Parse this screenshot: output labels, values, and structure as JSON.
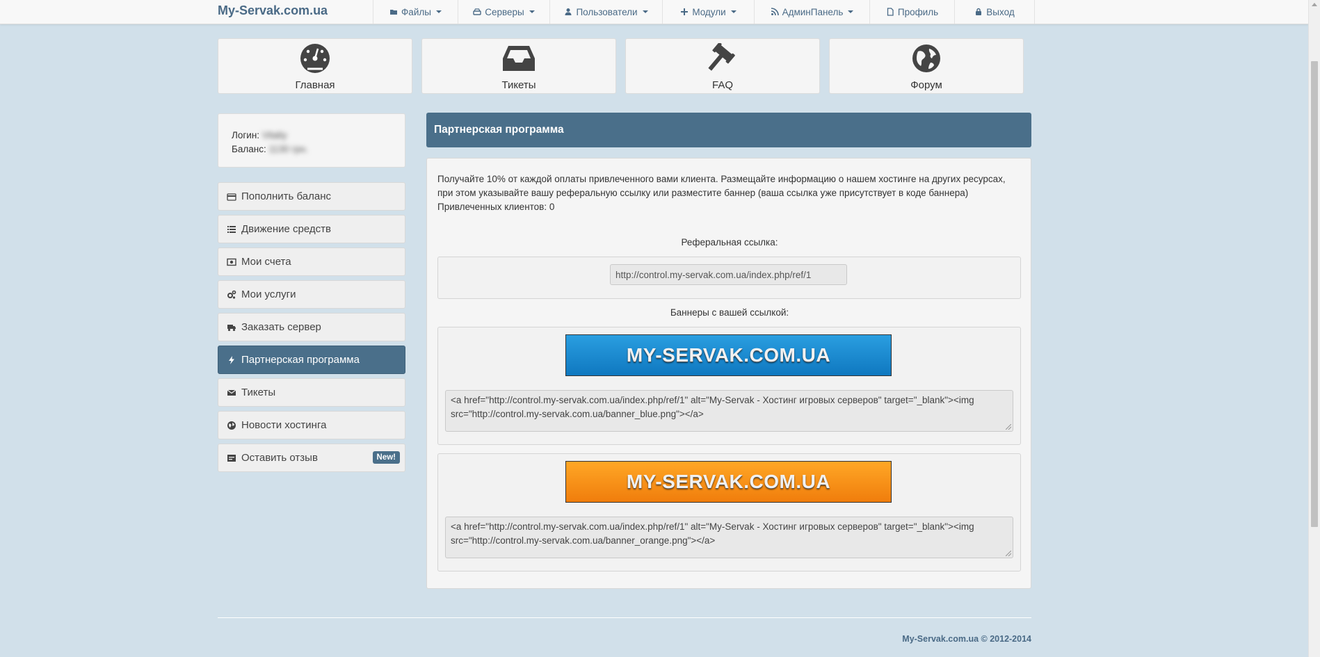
{
  "brand": "My-Servak.com.ua",
  "nav": [
    {
      "label": "Файлы",
      "icon": "folder-icon",
      "caret": true
    },
    {
      "label": "Серверы",
      "icon": "hdd-icon",
      "caret": true
    },
    {
      "label": "Пользователи",
      "icon": "user-icon",
      "caret": true
    },
    {
      "label": "Модули",
      "icon": "plus-icon",
      "caret": true
    },
    {
      "label": "АдминПанель",
      "icon": "rss-icon",
      "caret": true
    },
    {
      "label": "Профиль",
      "icon": "document-icon",
      "caret": false
    },
    {
      "label": "Выход",
      "icon": "lock-icon",
      "caret": false
    }
  ],
  "tiles": [
    {
      "label": "Главная",
      "icon": "dashboard-icon"
    },
    {
      "label": "Тикеты",
      "icon": "inbox-icon"
    },
    {
      "label": "FAQ",
      "icon": "gavel-icon"
    },
    {
      "label": "Форум",
      "icon": "globe-icon"
    }
  ],
  "user": {
    "login_label": "Логин:",
    "login_value": "Vitaliy",
    "balance_label": "Баланс:",
    "balance_value": "1130 грн."
  },
  "sidebar": [
    {
      "label": "Пополнить баланс",
      "icon": "credit-card-icon"
    },
    {
      "label": "Движение средств",
      "icon": "list-icon"
    },
    {
      "label": "Мои счета",
      "icon": "money-icon"
    },
    {
      "label": "Мои услуги",
      "icon": "cogs-icon"
    },
    {
      "label": "Заказать сервер",
      "icon": "truck-icon"
    },
    {
      "label": "Партнерская программа",
      "icon": "bolt-icon",
      "active": true
    },
    {
      "label": "Тикеты",
      "icon": "envelope-icon"
    },
    {
      "label": "Новости хостинга",
      "icon": "globe-icon"
    },
    {
      "label": "Оставить отзыв",
      "icon": "comment-icon",
      "badge": "New!"
    }
  ],
  "panel": {
    "title": "Партнерская программа",
    "description": "Получайте 10% от каждой оплаты привлеченного вами клиента. Размещайте информацию о нашем хостинге на других ресурсах, при этом указывайте вашу реферальную ссылку или разместите баннер (ваша ссылка уже присутствует в коде баннера)",
    "referred_label": "Привлеченных клиентов: 0",
    "ref_link_label": "Реферальная ссылка:",
    "ref_link_value": "http://control.my-servak.com.ua/index.php/ref/1",
    "banners_label": "Баннеры с вашей ссылкой:",
    "banners": [
      {
        "text": "MY-SERVAK.COM.UA",
        "color": "#1a8ad4",
        "code": "<a href=\"http://control.my-servak.com.ua/index.php/ref/1\" alt=\"My-Servak - Хостинг игровых серверов\" target=\"_blank\"><img src=\"http://control.my-servak.com.ua/banner_blue.png\"></a>"
      },
      {
        "text": "MY-SERVAK.COM.UA",
        "color": "#f7941d",
        "code": "<a href=\"http://control.my-servak.com.ua/index.php/ref/1\" alt=\"My-Servak - Хостинг игровых серверов\" target=\"_blank\"><img src=\"http://control.my-servak.com.ua/banner_orange.png\"></a>"
      }
    ]
  },
  "footer": "My-Servak.com.ua © 2012-2014",
  "colors": {
    "accent": "#4a6f8a",
    "background": "#d1e0ea",
    "link": "#4a6a86"
  }
}
